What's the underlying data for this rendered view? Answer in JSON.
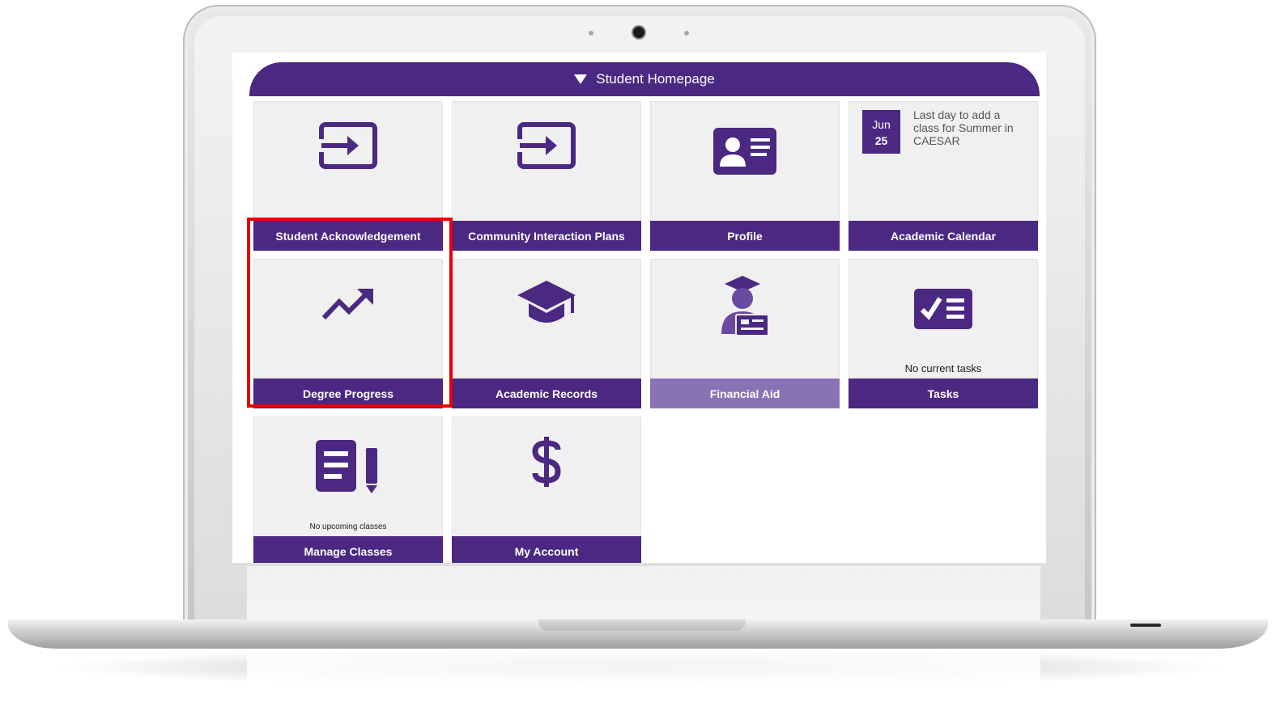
{
  "page": {
    "title": "Student Homepage"
  },
  "tiles": [
    {
      "label": "Student Acknowledgement",
      "icon": "sign-in-icon"
    },
    {
      "label": "Community Interaction Plans",
      "icon": "sign-in-icon"
    },
    {
      "label": "Profile",
      "icon": "id-card-icon"
    },
    {
      "label": "Academic Calendar",
      "icon": "calendar-icon"
    },
    {
      "label": "Degree Progress",
      "icon": "trending-up-icon"
    },
    {
      "label": "Academic Records",
      "icon": "graduation-cap-icon"
    },
    {
      "label": "Financial Aid",
      "icon": "graduate-with-card-icon"
    },
    {
      "label": "Tasks",
      "icon": "checklist-icon",
      "note": "No current tasks"
    },
    {
      "label": "Manage Classes",
      "icon": "notes-pencil-icon",
      "note": "No upcoming classes"
    },
    {
      "label": "My Account",
      "icon": "dollar-icon"
    }
  ],
  "calendar": {
    "month": "Jun",
    "day": "25",
    "event": "Last day to add a class for Summer in CAESAR"
  },
  "colors": {
    "brand": "#4b2882",
    "brand_light": "#8a73b5",
    "highlight": "#e80000"
  }
}
